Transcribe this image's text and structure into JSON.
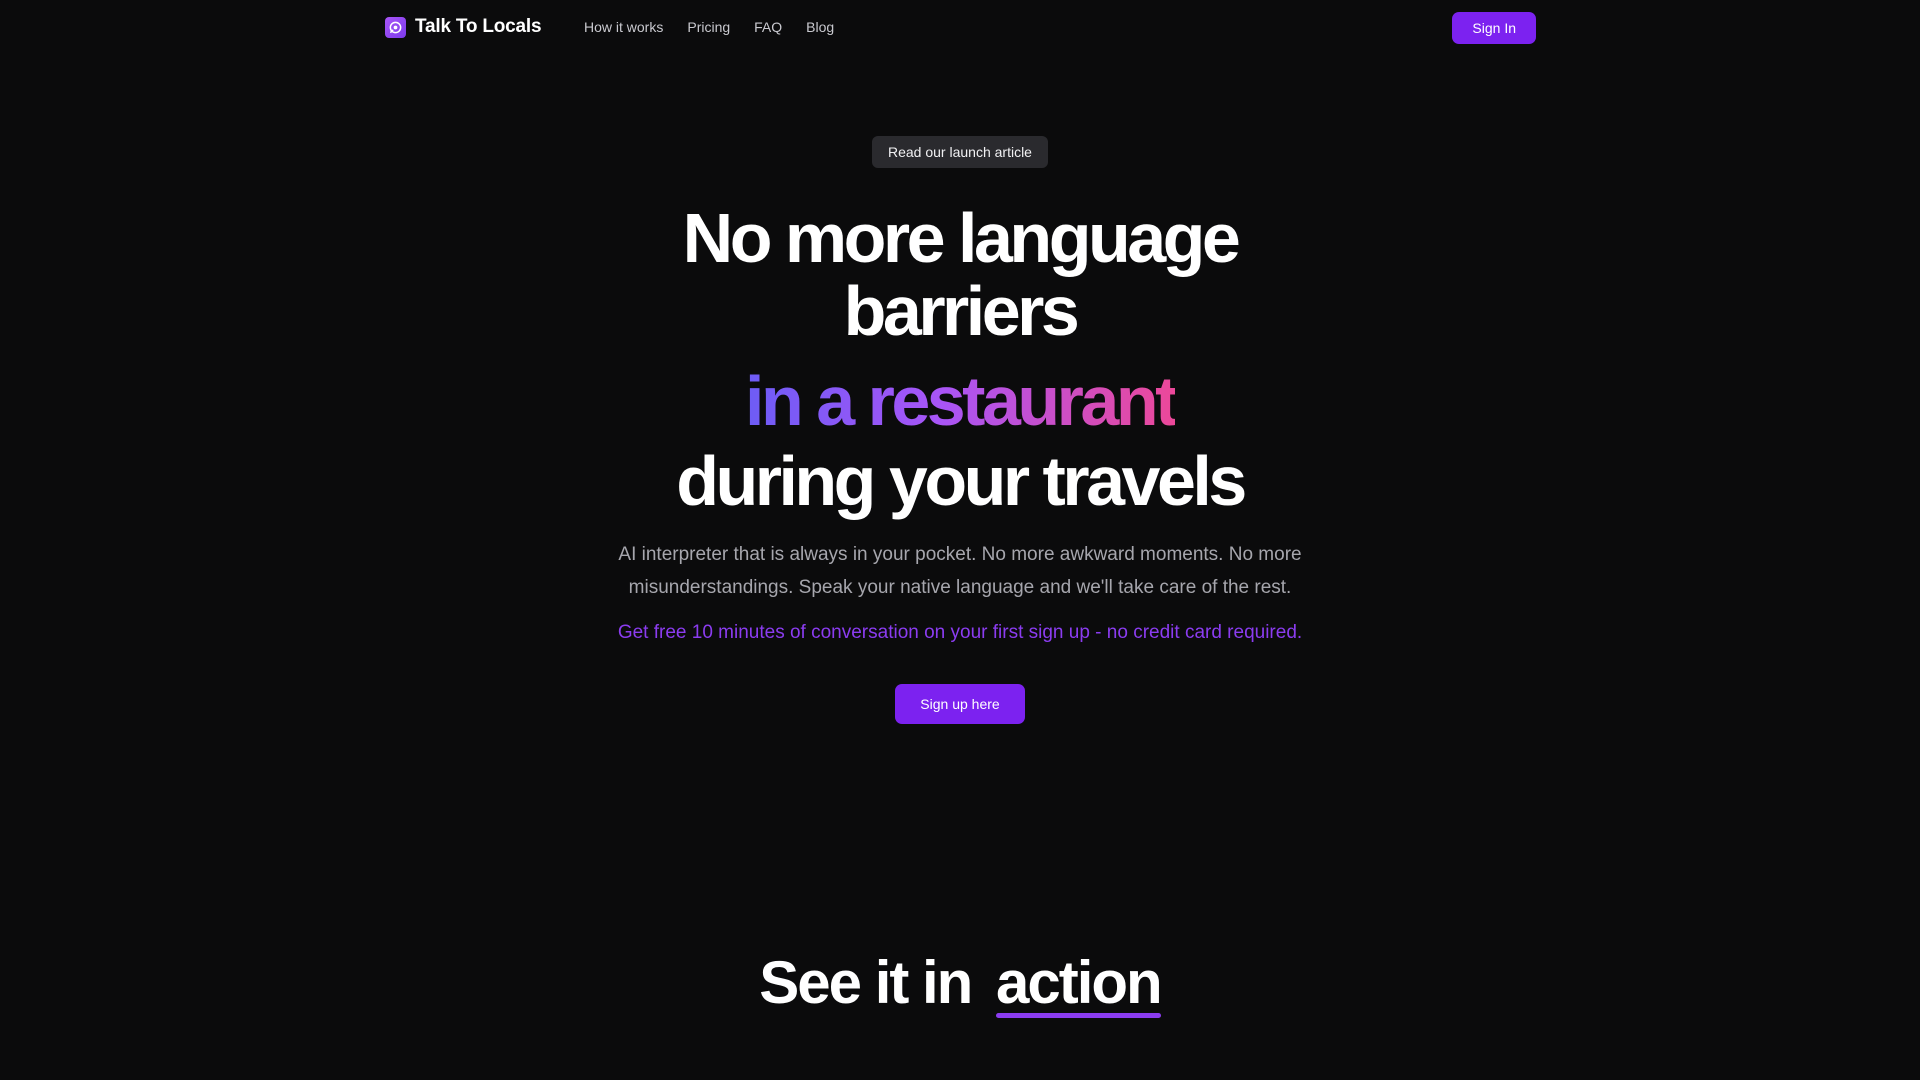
{
  "header": {
    "brand_name": "Talk To Locals",
    "brand_icon": "globe-chat-icon",
    "nav": [
      {
        "label": "How it works"
      },
      {
        "label": "Pricing"
      },
      {
        "label": "FAQ"
      },
      {
        "label": "Blog"
      }
    ],
    "signin_label": "Sign In"
  },
  "hero": {
    "launch_label": "Read our launch article",
    "headline_line1": "No more language",
    "headline_line2": "barriers",
    "headline_highlight": "in a restaurant",
    "headline_line3": "during your travels",
    "subtext": "AI interpreter that is always in your pocket. No more awkward moments. No more misunderstandings. Speak your native language and we'll take care of the rest.",
    "offer": "Get free 10 minutes of conversation on your first sign up - no credit card required.",
    "cta_label": "Sign up here"
  },
  "section": {
    "heading_prefix": "See it in",
    "heading_highlight": "action"
  },
  "colors": {
    "background": "#0b0b0c",
    "accent": "#7c22f0",
    "gradient_start": "#6d5cf6",
    "gradient_end": "#ec4899"
  }
}
